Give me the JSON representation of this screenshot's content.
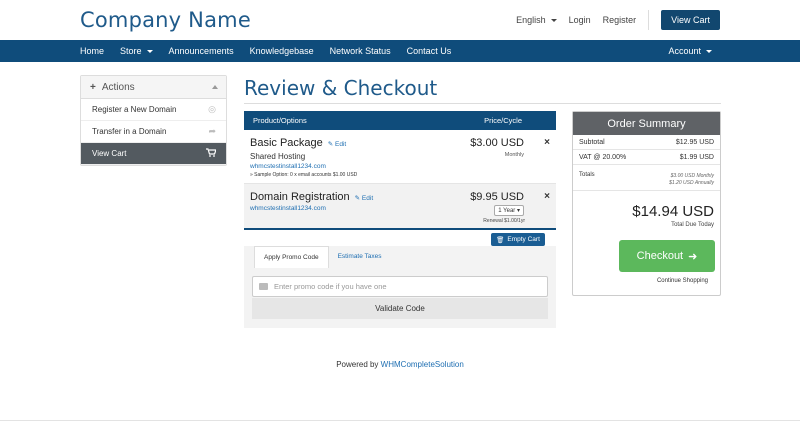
{
  "header": {
    "company_name": "Company Name",
    "language": "English",
    "login": "Login",
    "register": "Register",
    "view_cart": "View Cart"
  },
  "nav": {
    "items": [
      "Home",
      "Store",
      "Announcements",
      "Knowledgebase",
      "Network Status",
      "Contact Us"
    ],
    "account": "Account"
  },
  "sidebar": {
    "title": "Actions",
    "items": [
      {
        "label": "Register a New Domain",
        "icon": "globe-icon"
      },
      {
        "label": "Transfer in a Domain",
        "icon": "share-arrow-icon"
      },
      {
        "label": "View Cart",
        "icon": "cart-icon"
      }
    ]
  },
  "page": {
    "title": "Review & Checkout"
  },
  "cart": {
    "col_product": "Product/Options",
    "col_price": "Price/Cycle",
    "edit_label": "Edit",
    "rows": [
      {
        "name": "Basic Package",
        "group": "Shared Hosting",
        "domain": "whmcstestinstall1234.com",
        "option": "» Sample Option: 0 x email accounts $1.00 USD",
        "price": "$3.00 USD",
        "cycle": "Monthly"
      },
      {
        "name": "Domain Registration",
        "domain": "whmcstestinstall1234.com",
        "price": "$9.95 USD",
        "period": "1 Year",
        "renewal": "Renewal $1.00/1yr"
      }
    ],
    "empty_cart": "Empty Cart"
  },
  "promo": {
    "tab_promo": "Apply Promo Code",
    "tab_taxes": "Estimate Taxes",
    "placeholder": "Enter promo code if you have one",
    "validate": "Validate Code"
  },
  "summary": {
    "title": "Order Summary",
    "subtotal_label": "Subtotal",
    "subtotal": "$12.95 USD",
    "vat_label": "VAT @ 20.00%",
    "vat": "$1.99 USD",
    "totals_label": "Totals",
    "totals_monthly": "$3.00 USD Monthly",
    "totals_annually": "$1.20 USD Annually",
    "total": "$14.94 USD",
    "total_due": "Total Due Today",
    "checkout": "Checkout",
    "continue": "Continue Shopping"
  },
  "footer": {
    "powered_by": "Powered by",
    "link": "WHMCompleteSolution"
  },
  "colors": {
    "brand": "#0f4c7b",
    "checkout": "#5cb85c",
    "summary_head": "#5f6266"
  }
}
